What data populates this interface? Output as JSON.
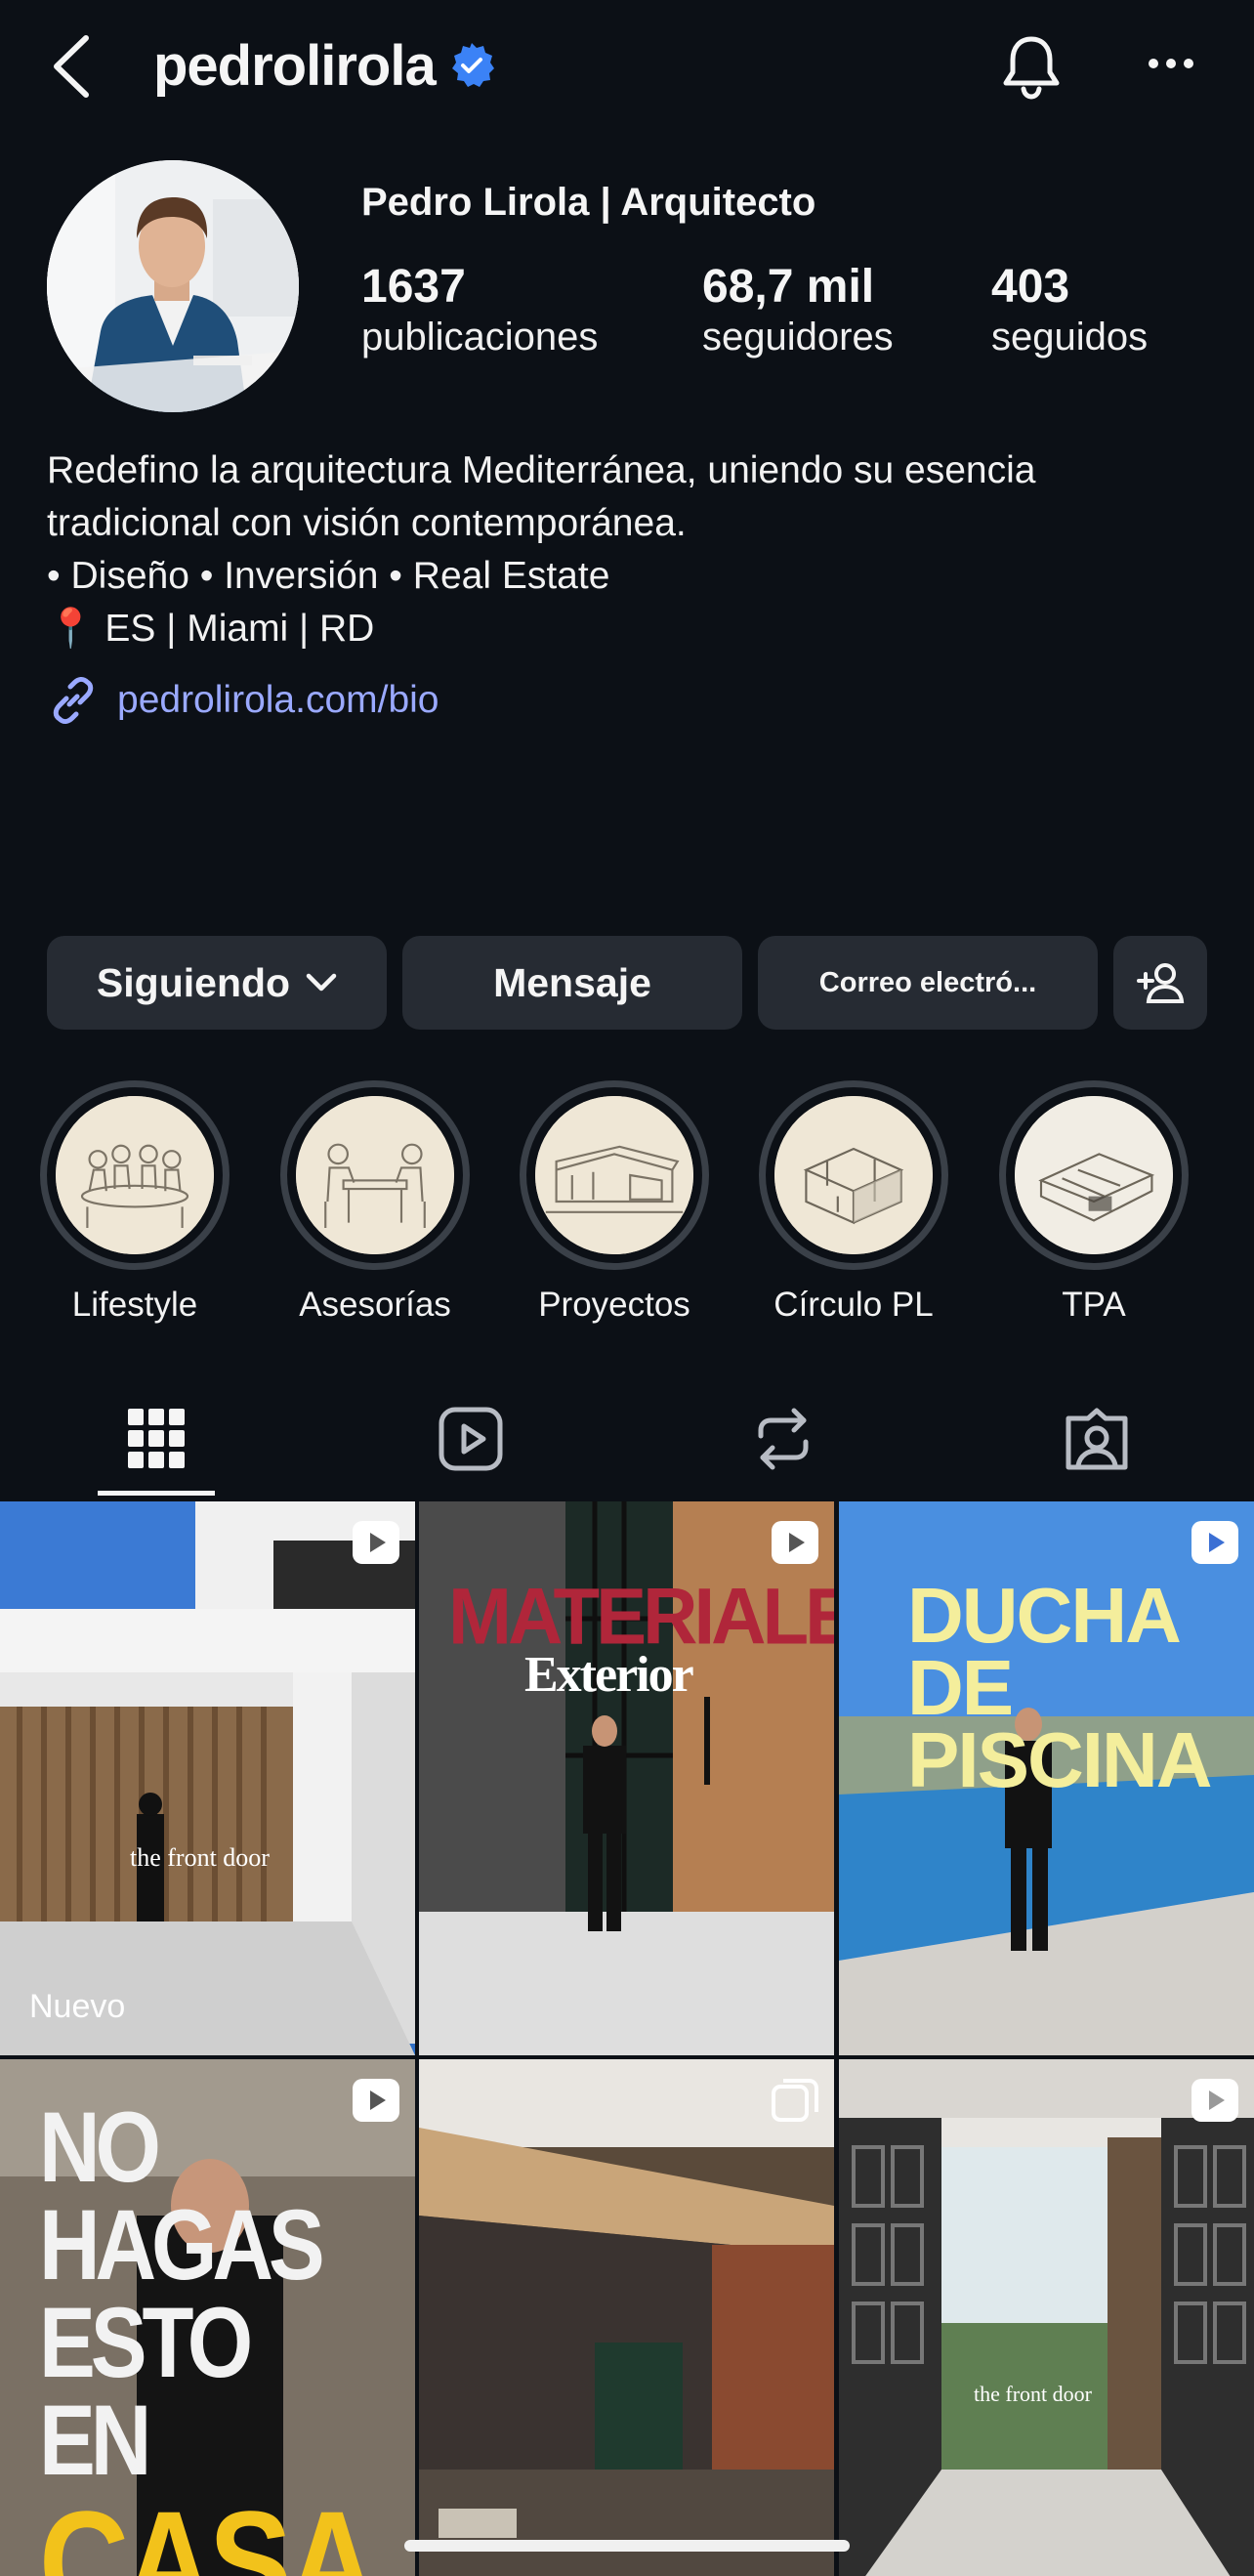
{
  "header": {
    "username": "pedrolirola",
    "verified": true,
    "display_name": "Pedro Lirola | Arquitecto"
  },
  "stats": {
    "posts": {
      "value": "1637",
      "label": "publicaciones"
    },
    "followers": {
      "value": "68,7 mil",
      "label": "seguidores"
    },
    "following": {
      "value": "403",
      "label": "seguidos"
    }
  },
  "bio": {
    "line1": "Redefino la arquitectura Mediterránea, uniendo su esencia",
    "line2": "tradicional con visión contemporánea.",
    "line3": "• Diseño • Inversión • Real Estate",
    "line4": "📍 ES | Miami | RD",
    "link": "pedrolirola.com/bio"
  },
  "actions": {
    "following_label": "Siguiendo",
    "message_label": "Mensaje",
    "email_label": "Correo electró..."
  },
  "highlights": [
    {
      "label": "Lifestyle"
    },
    {
      "label": "Asesorías"
    },
    {
      "label": "Proyectos"
    },
    {
      "label": "Círculo PL"
    },
    {
      "label": "TPA"
    }
  ],
  "tabs": {
    "active": "grid",
    "icons": [
      "grid-icon",
      "reels-icon",
      "reposts-icon",
      "tagged-icon"
    ]
  },
  "posts": [
    {
      "type": "reel",
      "caption_overlay": "the front door",
      "badge": "Nuevo"
    },
    {
      "type": "reel",
      "title_line1": "MATERIALES",
      "title_line2": "Exterior"
    },
    {
      "type": "reel",
      "title_line1": "DUCHA",
      "title_line2": "DE",
      "title_line3": "PISCINA"
    },
    {
      "type": "reel",
      "title_line1": "NO HAGAS",
      "title_line2": "ESTO EN",
      "title_line3": "CASA"
    },
    {
      "type": "carousel"
    },
    {
      "type": "reel",
      "caption_overlay": "the front door"
    }
  ],
  "colors": {
    "background": "#0c1016",
    "button": "#262b33",
    "link": "#9aa9ff",
    "verified": "#3b82f6",
    "materiales_red": "#b0263a",
    "ducha_yellow": "#f4ee9c",
    "casa_yellow": "#f2c21b"
  }
}
